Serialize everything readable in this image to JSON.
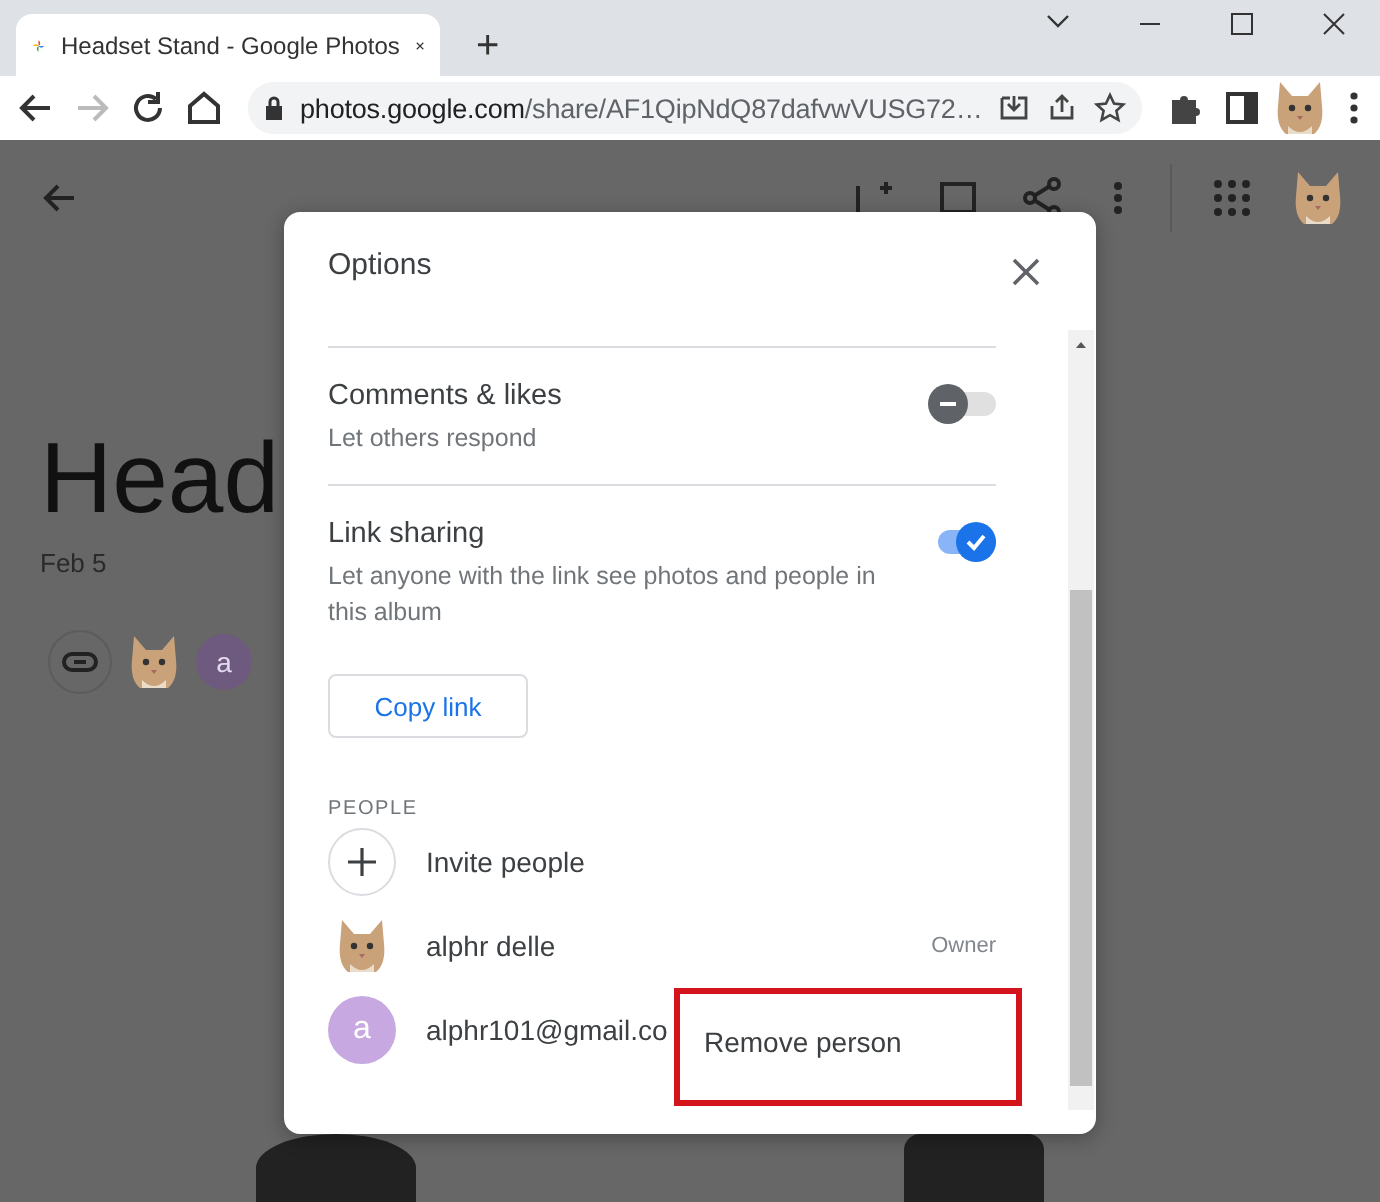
{
  "browser": {
    "tab_title": "Headset Stand - Google Photos",
    "new_tab": "+",
    "address_host": "photos.google.com",
    "address_path": "/share/AF1QipNdQ87dafvwVUSG72…"
  },
  "album": {
    "title": "Head",
    "date": "Feb 5",
    "member_initial": "a"
  },
  "dialog": {
    "title": "Options",
    "settings": [
      {
        "title": "Comments & likes",
        "description": "Let others respond",
        "on": false
      },
      {
        "title": "Link sharing",
        "description": "Let anyone with the link see photos and people in this album",
        "on": true
      }
    ],
    "copy_link": "Copy link",
    "people_heading": "PEOPLE",
    "invite": "Invite people",
    "people": [
      {
        "kind": "photo",
        "name": "alphr delle",
        "role": "Owner"
      },
      {
        "kind": "letter",
        "initial": "a",
        "name": "alphr101@gmail.co"
      }
    ]
  },
  "menu": {
    "items": [
      "Remove person"
    ],
    "highlighted": true
  }
}
